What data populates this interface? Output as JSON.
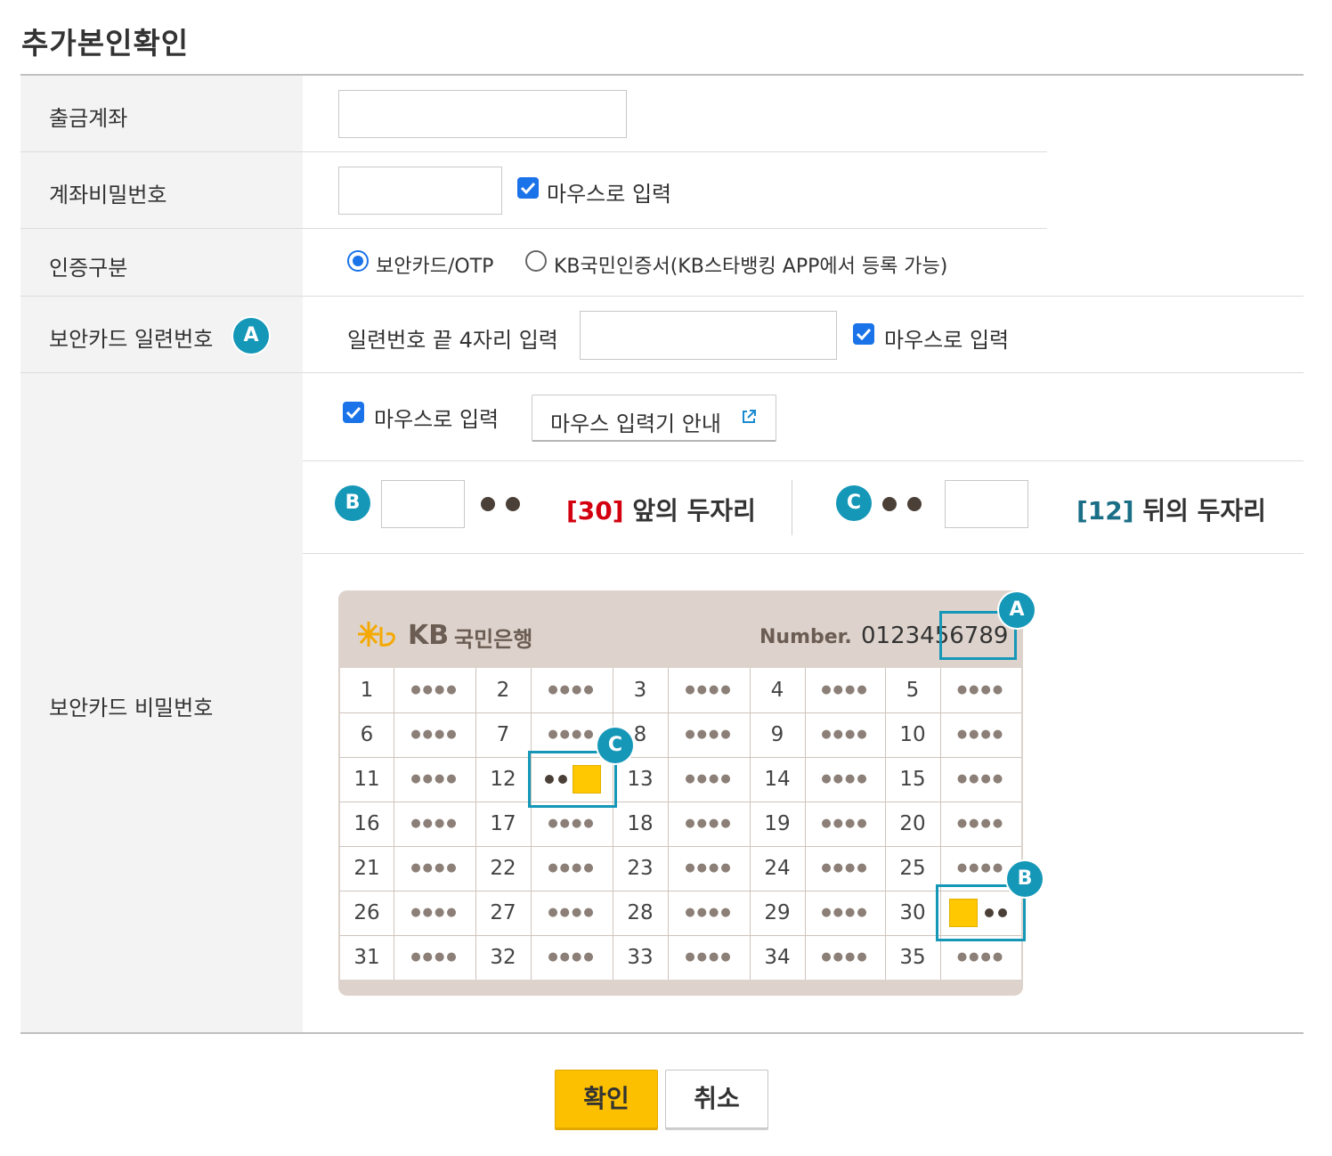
{
  "page_title": "추가본인확인",
  "rows": {
    "account": {
      "label": "출금계좌",
      "value": ""
    },
    "password": {
      "label": "계좌비밀번호",
      "value": "",
      "mouse_label": "마우스로 입력",
      "mouse_checked": true
    },
    "auth": {
      "label": "인증구분",
      "options": [
        "보안카드/OTP",
        "KB국민인증서(KB스타뱅킹 APP에서 등록 가능)"
      ],
      "selected": 0
    },
    "serial": {
      "label": "보안카드 일련번호",
      "badge": "A",
      "prompt": "일련번호 끝 4자리 입력",
      "value": "",
      "mouse_label": "마우스로 입력",
      "mouse_checked": true
    },
    "card_pw": {
      "label": "보안카드 비밀번호",
      "mouse_label": "마우스로 입력",
      "mouse_checked": true,
      "guide_button": "마우스 입력기 안내",
      "front": {
        "badge": "B",
        "value": "",
        "number": "[30]",
        "text": "앞의 두자리"
      },
      "back": {
        "badge": "C",
        "value": "",
        "number": "[12]",
        "text": "뒤의 두자리"
      }
    }
  },
  "card": {
    "bank_name": "KB국민은행",
    "bank_prefix": "KB",
    "bank_suffix": "국민은행",
    "number_label": "Number.",
    "number": "0123456789",
    "cells": [
      "1",
      "2",
      "3",
      "4",
      "5",
      "6",
      "7",
      "8",
      "9",
      "10",
      "11",
      "12",
      "13",
      "14",
      "15",
      "16",
      "17",
      "18",
      "19",
      "20",
      "21",
      "22",
      "23",
      "24",
      "25",
      "26",
      "27",
      "28",
      "29",
      "30",
      "31",
      "32",
      "33",
      "34",
      "35"
    ],
    "mask": "●●●●",
    "badges": {
      "a": "A",
      "b": "B",
      "c": "C"
    },
    "accent_color": "#1597b8",
    "highlight_color": "#ffc800"
  },
  "buttons": {
    "confirm": "확인",
    "cancel": "취소"
  }
}
